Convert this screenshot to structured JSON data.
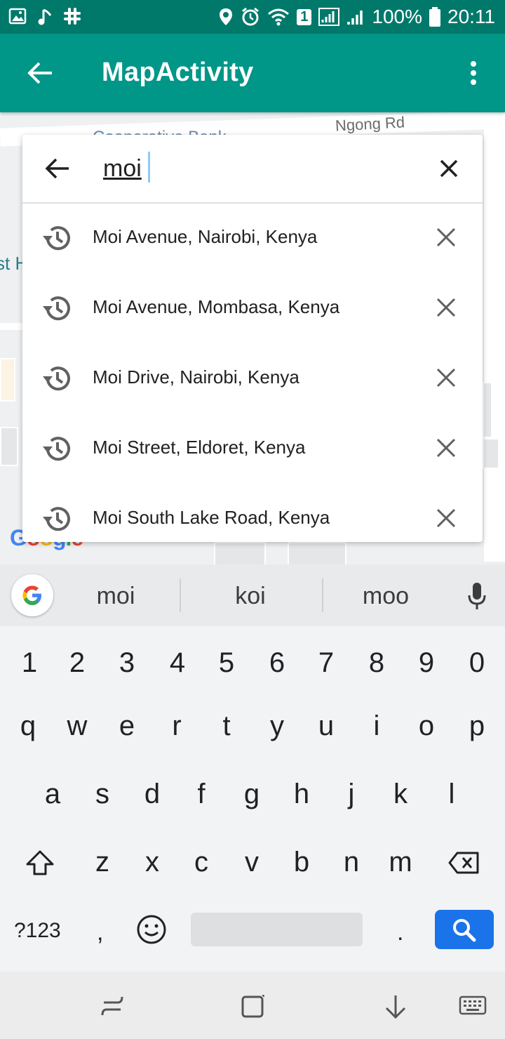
{
  "status_bar": {
    "battery": "100%",
    "time": "20:11",
    "sim_badge": "1"
  },
  "app_bar": {
    "title": "MapActivity"
  },
  "map": {
    "labels": [
      "Ngong Rd",
      "Cooperative Bank",
      "st H"
    ]
  },
  "search": {
    "query": "moi"
  },
  "suggestions": [
    {
      "label": "Moi Avenue, Nairobi, Kenya"
    },
    {
      "label": "Moi Avenue, Mombasa, Kenya"
    },
    {
      "label": "Moi Drive, Nairobi, Kenya"
    },
    {
      "label": "Moi Street, Eldoret, Kenya"
    },
    {
      "label": "Moi South Lake Road, Kenya"
    }
  ],
  "keyboard": {
    "suggestions": [
      "moi",
      "koi",
      "moo"
    ],
    "number_row": [
      "1",
      "2",
      "3",
      "4",
      "5",
      "6",
      "7",
      "8",
      "9",
      "0"
    ],
    "row1": [
      "q",
      "w",
      "e",
      "r",
      "t",
      "y",
      "u",
      "i",
      "o",
      "p"
    ],
    "row2": [
      "a",
      "s",
      "d",
      "f",
      "g",
      "h",
      "j",
      "k",
      "l"
    ],
    "row3": [
      "z",
      "x",
      "c",
      "v",
      "b",
      "n",
      "m"
    ],
    "symbols_key": "?123",
    "comma_key": ",",
    "period_key": "."
  },
  "colors": {
    "primary": "#009688",
    "primary_dark": "#00796b",
    "search_key": "#1a73e8"
  }
}
